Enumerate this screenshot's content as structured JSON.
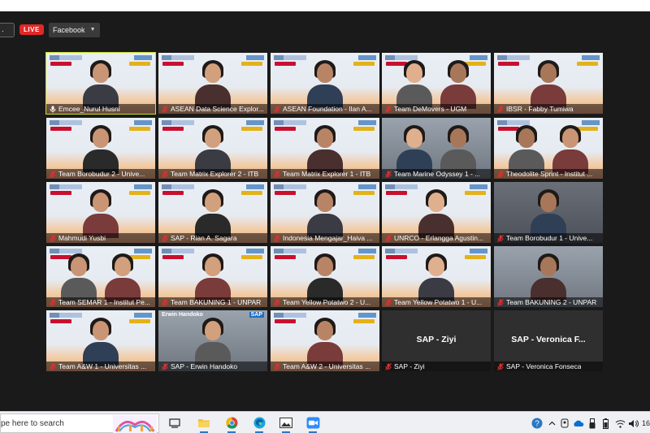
{
  "top": {
    "live_label": "LIVE",
    "stream_target": "Facebook",
    "lead_text": "."
  },
  "tiles": [
    {
      "name": "Emcee_Nurul Husni",
      "muted": false,
      "style": "banner",
      "active": true
    },
    {
      "name": "ASEAN Data Science Explor...",
      "muted": true,
      "style": "banner"
    },
    {
      "name": "ASEAN Foundation - Ilan A...",
      "muted": true,
      "style": "banner"
    },
    {
      "name": "Team DeMovers - UGM",
      "muted": true,
      "style": "banner",
      "pair": true
    },
    {
      "name": "IBSR - Fabby Tumiwa",
      "muted": true,
      "style": "banner"
    },
    {
      "name": "Team Borobudur 2 - Unive...",
      "muted": true,
      "style": "banner"
    },
    {
      "name": "Team Matrix Explorer 2 - ITB",
      "muted": true,
      "style": "banner"
    },
    {
      "name": "Team Matrix Explorer 1 - ITB",
      "muted": true,
      "style": "banner"
    },
    {
      "name": "Team Marine Odyssey 1 - ...",
      "muted": true,
      "style": "room",
      "pair": true
    },
    {
      "name": "Theodolite Sprint - Institut ...",
      "muted": true,
      "style": "banner",
      "pair": true
    },
    {
      "name": "Mahmudi Yusbi",
      "muted": true,
      "style": "banner"
    },
    {
      "name": "SAP - Rian A. Sagara",
      "muted": true,
      "style": "banner"
    },
    {
      "name": "Indonesia Mengajar_Haiva ...",
      "muted": true,
      "style": "banner"
    },
    {
      "name": "UNRCO - Erlangga Agustin...",
      "muted": true,
      "style": "banner"
    },
    {
      "name": "Team Borobudur 1 - Unive...",
      "muted": true,
      "style": "plain"
    },
    {
      "name": "Team SEMAR 1 - Institut Pe...",
      "muted": true,
      "style": "banner",
      "pair": true
    },
    {
      "name": "Team BAKUNING 1 - UNPAR",
      "muted": true,
      "style": "banner"
    },
    {
      "name": "Team Yellow Potatwo 2 - U...",
      "muted": true,
      "style": "banner"
    },
    {
      "name": "Team Yellow Potatwo 1 - U...",
      "muted": true,
      "style": "banner"
    },
    {
      "name": "Team BAKUNING 2 - UNPAR",
      "muted": true,
      "style": "room"
    },
    {
      "name": "Team A&W 1 - Universitas ...",
      "muted": true,
      "style": "banner"
    },
    {
      "name": "SAP - Erwin Handoko",
      "muted": true,
      "style": "room",
      "overlay_title": "Erwin Handoko",
      "overlay_logo": "SAP"
    },
    {
      "name": "Team A&W 2 - Universitas ...",
      "muted": true,
      "style": "banner"
    },
    {
      "name": "SAP - Ziyi",
      "muted": true,
      "style": "dark",
      "big": "SAP - Ziyi"
    },
    {
      "name": "SAP - Veronica Fonseca",
      "muted": true,
      "style": "dark",
      "big": "SAP - Veronica F..."
    }
  ],
  "taskbar": {
    "search_placeholder": "pe here to search",
    "apps": [
      "task-view-icon",
      "file-explorer-icon",
      "chrome-icon",
      "edge-icon",
      "photos-icon",
      "zoom-icon"
    ],
    "tray": [
      "help-icon",
      "chevron-up-icon",
      "meet-now-icon",
      "onedrive-icon",
      "usb-icon",
      "battery-icon",
      "wifi-icon",
      "volume-icon"
    ],
    "clock_text": "16"
  },
  "colors": {
    "active_border": "#c9de2e",
    "live": "#e02828",
    "muted_mic": "#e0302e"
  }
}
